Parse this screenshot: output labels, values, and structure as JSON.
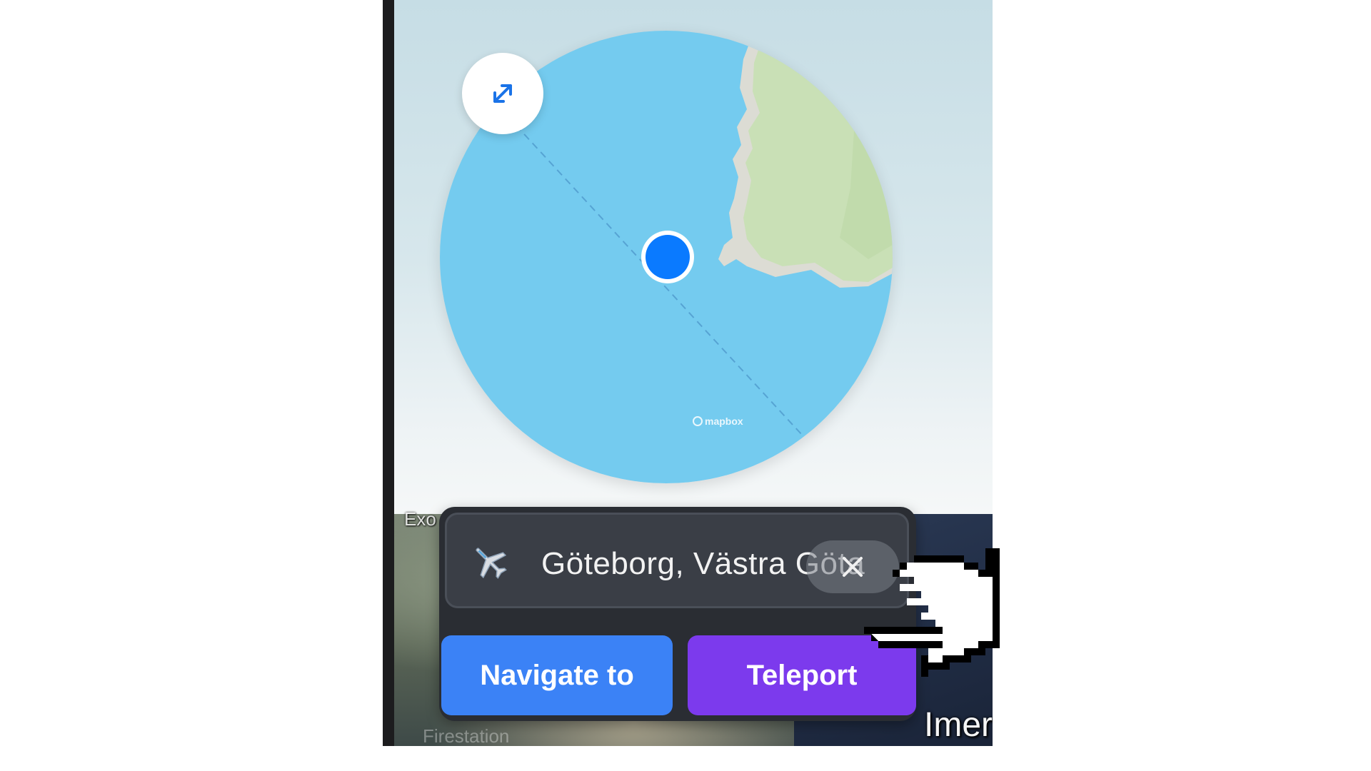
{
  "minimap": {
    "attribution": "mapbox",
    "colors": {
      "water": "#74cbef",
      "land": "#c9e0b6",
      "user_marker": "#0a7aff"
    },
    "expand_icon": "expand-diagonal-icon"
  },
  "terrain_labels": {
    "top_left": "Exo",
    "bottom_right": "Imer",
    "bottom_faint": "Firestation"
  },
  "search": {
    "icon": "airplane-icon",
    "value": "Göteborg, Västra Göta",
    "clear_icon": "close-icon"
  },
  "actions": {
    "navigate_label": "Navigate to",
    "teleport_label": "Teleport"
  },
  "colors": {
    "panel_bg": "#2a2d33",
    "navigate": "#3b82f6",
    "teleport": "#7c3aed"
  }
}
